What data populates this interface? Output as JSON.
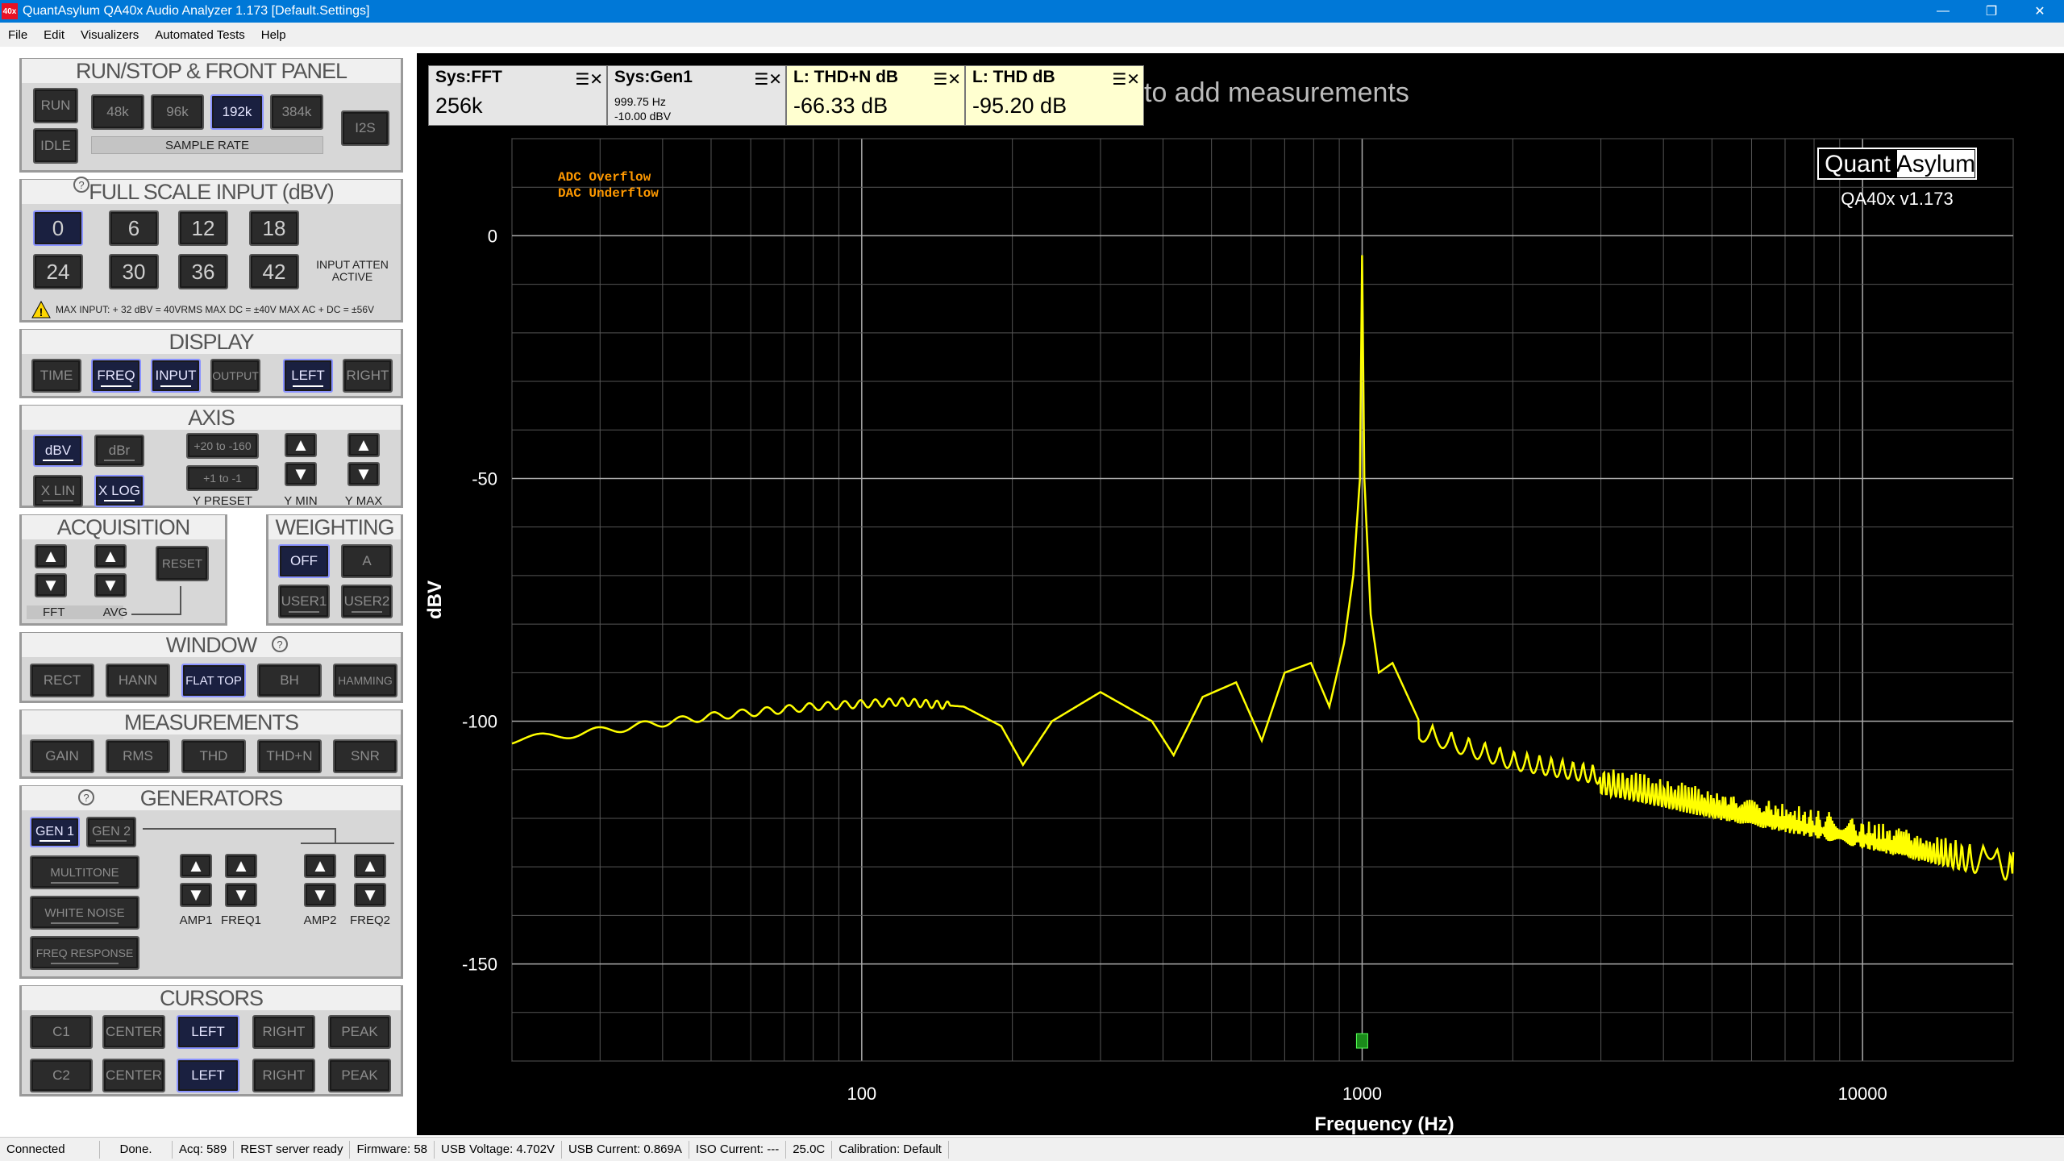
{
  "window": {
    "title": "QuantAsylum QA40x Audio Analyzer 1.173 [Default.Settings]",
    "icon_text": "40x"
  },
  "menu": [
    "File",
    "Edit",
    "Visualizers",
    "Automated Tests",
    "Help"
  ],
  "run_panel": {
    "title": "RUN/STOP & FRONT PANEL",
    "run": "RUN",
    "idle": "IDLE",
    "rates": [
      "48k",
      "96k",
      "192k",
      "384k"
    ],
    "rate_label": "SAMPLE RATE",
    "i2s": "I2S"
  },
  "fsi_panel": {
    "title": "FULL SCALE INPUT (dBV)",
    "values": [
      "0",
      "6",
      "12",
      "18",
      "24",
      "30",
      "36",
      "42"
    ],
    "atten_label": "INPUT ATTEN ACTIVE",
    "warning": "MAX INPUT: + 32 dBV = 40VRMS     MAX DC = ±40V     MAX AC + DC = ±56V"
  },
  "display_panel": {
    "title": "DISPLAY",
    "buttons": [
      "TIME",
      "FREQ",
      "INPUT",
      "OUTPUT",
      "LEFT",
      "RIGHT"
    ]
  },
  "axis_panel": {
    "title": "AXIS",
    "dbv": "dBV",
    "dbr": "dBr",
    "xlin": "X LIN",
    "xlog": "X LOG",
    "preset1": "+20 to -160",
    "preset2": "+1 to -1",
    "ypreset": "Y PRESET",
    "ymin": "Y MIN",
    "ymax": "Y MAX"
  },
  "acq_panel": {
    "title": "ACQUISITION",
    "reset": "RESET",
    "fft": "FFT",
    "avg": "AVG"
  },
  "weight_panel": {
    "title": "WEIGHTING",
    "buttons": [
      "OFF",
      "A",
      "USER1",
      "USER2"
    ]
  },
  "window_panel": {
    "title": "WINDOW",
    "buttons": [
      "RECT",
      "HANN",
      "FLAT TOP",
      "BH",
      "HAMMING"
    ]
  },
  "meas_panel": {
    "title": "MEASUREMENTS",
    "buttons": [
      "GAIN",
      "RMS",
      "THD",
      "THD+N",
      "SNR"
    ]
  },
  "gen_panel": {
    "title": "GENERATORS",
    "gen1": "GEN 1",
    "gen2": "GEN 2",
    "multitone": "MULTITONE",
    "whitenoise": "WHITE NOISE",
    "freqresp": "FREQ RESPONSE",
    "labels": [
      "AMP1",
      "FREQ1",
      "AMP2",
      "FREQ2"
    ]
  },
  "cursor_panel": {
    "title": "CURSORS",
    "row1": [
      "C1",
      "CENTER",
      "LEFT",
      "RIGHT",
      "PEAK"
    ],
    "row2": [
      "C2",
      "CENTER",
      "LEFT",
      "RIGHT",
      "PEAK"
    ]
  },
  "measurements": [
    {
      "title": "Sys:FFT",
      "value": "256k"
    },
    {
      "title": "Sys:Gen1",
      "sub1": "999.75 Hz",
      "sub2": "-10.00 dBV"
    },
    {
      "title": "L: THD+N dB",
      "value": "-66.33 dB"
    },
    {
      "title": "L: THD dB",
      "value": "-95.20 dB"
    }
  ],
  "add_hint": "to add measurements",
  "logo": {
    "left": "Quant",
    "right": "Asylum",
    "version": "QA40x v1.173"
  },
  "flags": {
    "adc": "ADC Overflow",
    "dac": "DAC Underflow"
  },
  "colors": {
    "trace": "#ffff00",
    "flags": "#ff9900",
    "accent": "#8a93ff"
  },
  "chart_data": {
    "type": "line",
    "xlabel": "Frequency (Hz)",
    "ylabel": "dBV",
    "xscale": "log",
    "xlim": [
      20,
      20000
    ],
    "ylim": [
      -170,
      20
    ],
    "xticks": [
      100,
      1000,
      10000
    ],
    "yticks": [
      0,
      -50,
      -100,
      -150
    ],
    "grid": true,
    "series": [
      {
        "x": [
          20,
          30,
          50,
          80,
          120,
          160,
          190,
          210,
          240,
          300,
          380,
          420,
          480,
          560,
          630,
          700,
          790,
          860,
          920,
          960,
          990,
          999.75,
          1010,
          1040,
          1080,
          1150,
          1300,
          1600,
          2000,
          3000,
          5000,
          8000,
          12000,
          20000
        ],
        "y": [
          -104,
          -102,
          -99,
          -97,
          -96,
          -97,
          -101,
          -109,
          -100,
          -94,
          -100,
          -107,
          -95,
          -92,
          -104,
          -90,
          -88,
          -97,
          -84,
          -70,
          -50,
          -4,
          -50,
          -78,
          -90,
          -88,
          -100,
          -103,
          -106,
          -109,
          -114,
          -118,
          -122,
          -127
        ]
      }
    ]
  },
  "status": [
    "Connected",
    "Done.",
    "Acq: 589",
    "REST server ready",
    "Firmware: 58",
    "USB Voltage: 4.702V",
    "USB Current: 0.869A",
    "ISO Current: ---",
    "25.0C",
    "Calibration: Default"
  ]
}
